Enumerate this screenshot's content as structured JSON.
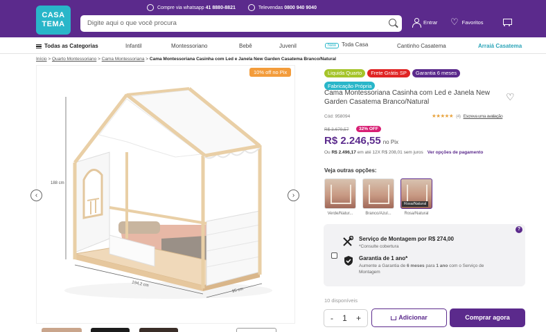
{
  "header": {
    "logo_line1": "CASA",
    "logo_line2": "TEMA",
    "whatsapp_label": "Compre via whatsapp",
    "whatsapp_number": "41 8880-8821",
    "phone_label": "Televendas",
    "phone_number": "0800 940 9040",
    "search_placeholder": "Digite aqui o que você procura",
    "login_label": "Entrar",
    "favorites_label": "Favoritos"
  },
  "nav": {
    "all_categories": "Todas as Categorias",
    "items": [
      "Infantil",
      "Montessoriano",
      "Bebê",
      "Juvenil",
      "Toda Casa",
      "Cantinho Casatema",
      "Arraiá Casatema"
    ],
    "new_tag": "New"
  },
  "breadcrumb": {
    "items": [
      "Início",
      "Quarto Montessoriano",
      "Cama Montessoriana"
    ],
    "current": "Cama Montessoriana Casinha com Led e Janela New Garden Casatema Branco/Natural",
    "separator": ">"
  },
  "gallery": {
    "promo_tag": "10% off no Pix",
    "dim_height": "188 cm",
    "dim_width": "194,2 cm",
    "dim_depth": "95 cm"
  },
  "product": {
    "badges": [
      {
        "label": "Liquida Quarto",
        "color": "#a5c42a"
      },
      {
        "label": "Frete Grátis SP",
        "color": "#e02424"
      },
      {
        "label": "Garantia 6 meses",
        "color": "#5b2a8c"
      },
      {
        "label": "Fabricação Própria",
        "color": "#29b6c9"
      }
    ],
    "title": "Cama Montessoriana Casinha com Led e Janela New Garden Casatema Branco/Natural",
    "code": "Cód: 958094",
    "rating_stars": "★★★★★",
    "rating_value": 4.5,
    "rating_count": "(4)",
    "review_link": "Escreva uma avaliação",
    "old_price": "R$ 3.679,57",
    "discount": "32% OFF",
    "price": "R$ 2.246,55",
    "price_suffix": "no Pix",
    "installments_prefix": "Ou",
    "installments_total": "R$ 2.496,17",
    "installments_detail": "em até 12X R$ 208,01 sem juros",
    "payment_options": "Ver opções de pagamento"
  },
  "variants": {
    "label": "Veja outras opções:",
    "items": [
      {
        "label": "Verde/Natur..."
      },
      {
        "label": "Branco/Azul..."
      },
      {
        "label": "Rosa/Natural"
      }
    ],
    "hover_tag": "Rosa/Natural"
  },
  "services": {
    "help_icon": "?",
    "assembly_title": "Serviço de Montagem por R$ 274,00",
    "assembly_sub": "*Consulte cobertura",
    "warranty_title": "Garantia de 1 ano*",
    "warranty_sub_1": "Aumente a Garantia de ",
    "warranty_sub_bold1": "6 meses",
    "warranty_sub_2": " para ",
    "warranty_sub_bold2": "1 ano",
    "warranty_sub_3": " com o Serviço de",
    "warranty_sub_4": "Montagem"
  },
  "purchase": {
    "stock": "10 disponíveis",
    "qty_minus": "-",
    "qty_value": "1",
    "qty_plus": "+",
    "add_label": "Adicionar",
    "buy_label": "Comprar agora"
  }
}
